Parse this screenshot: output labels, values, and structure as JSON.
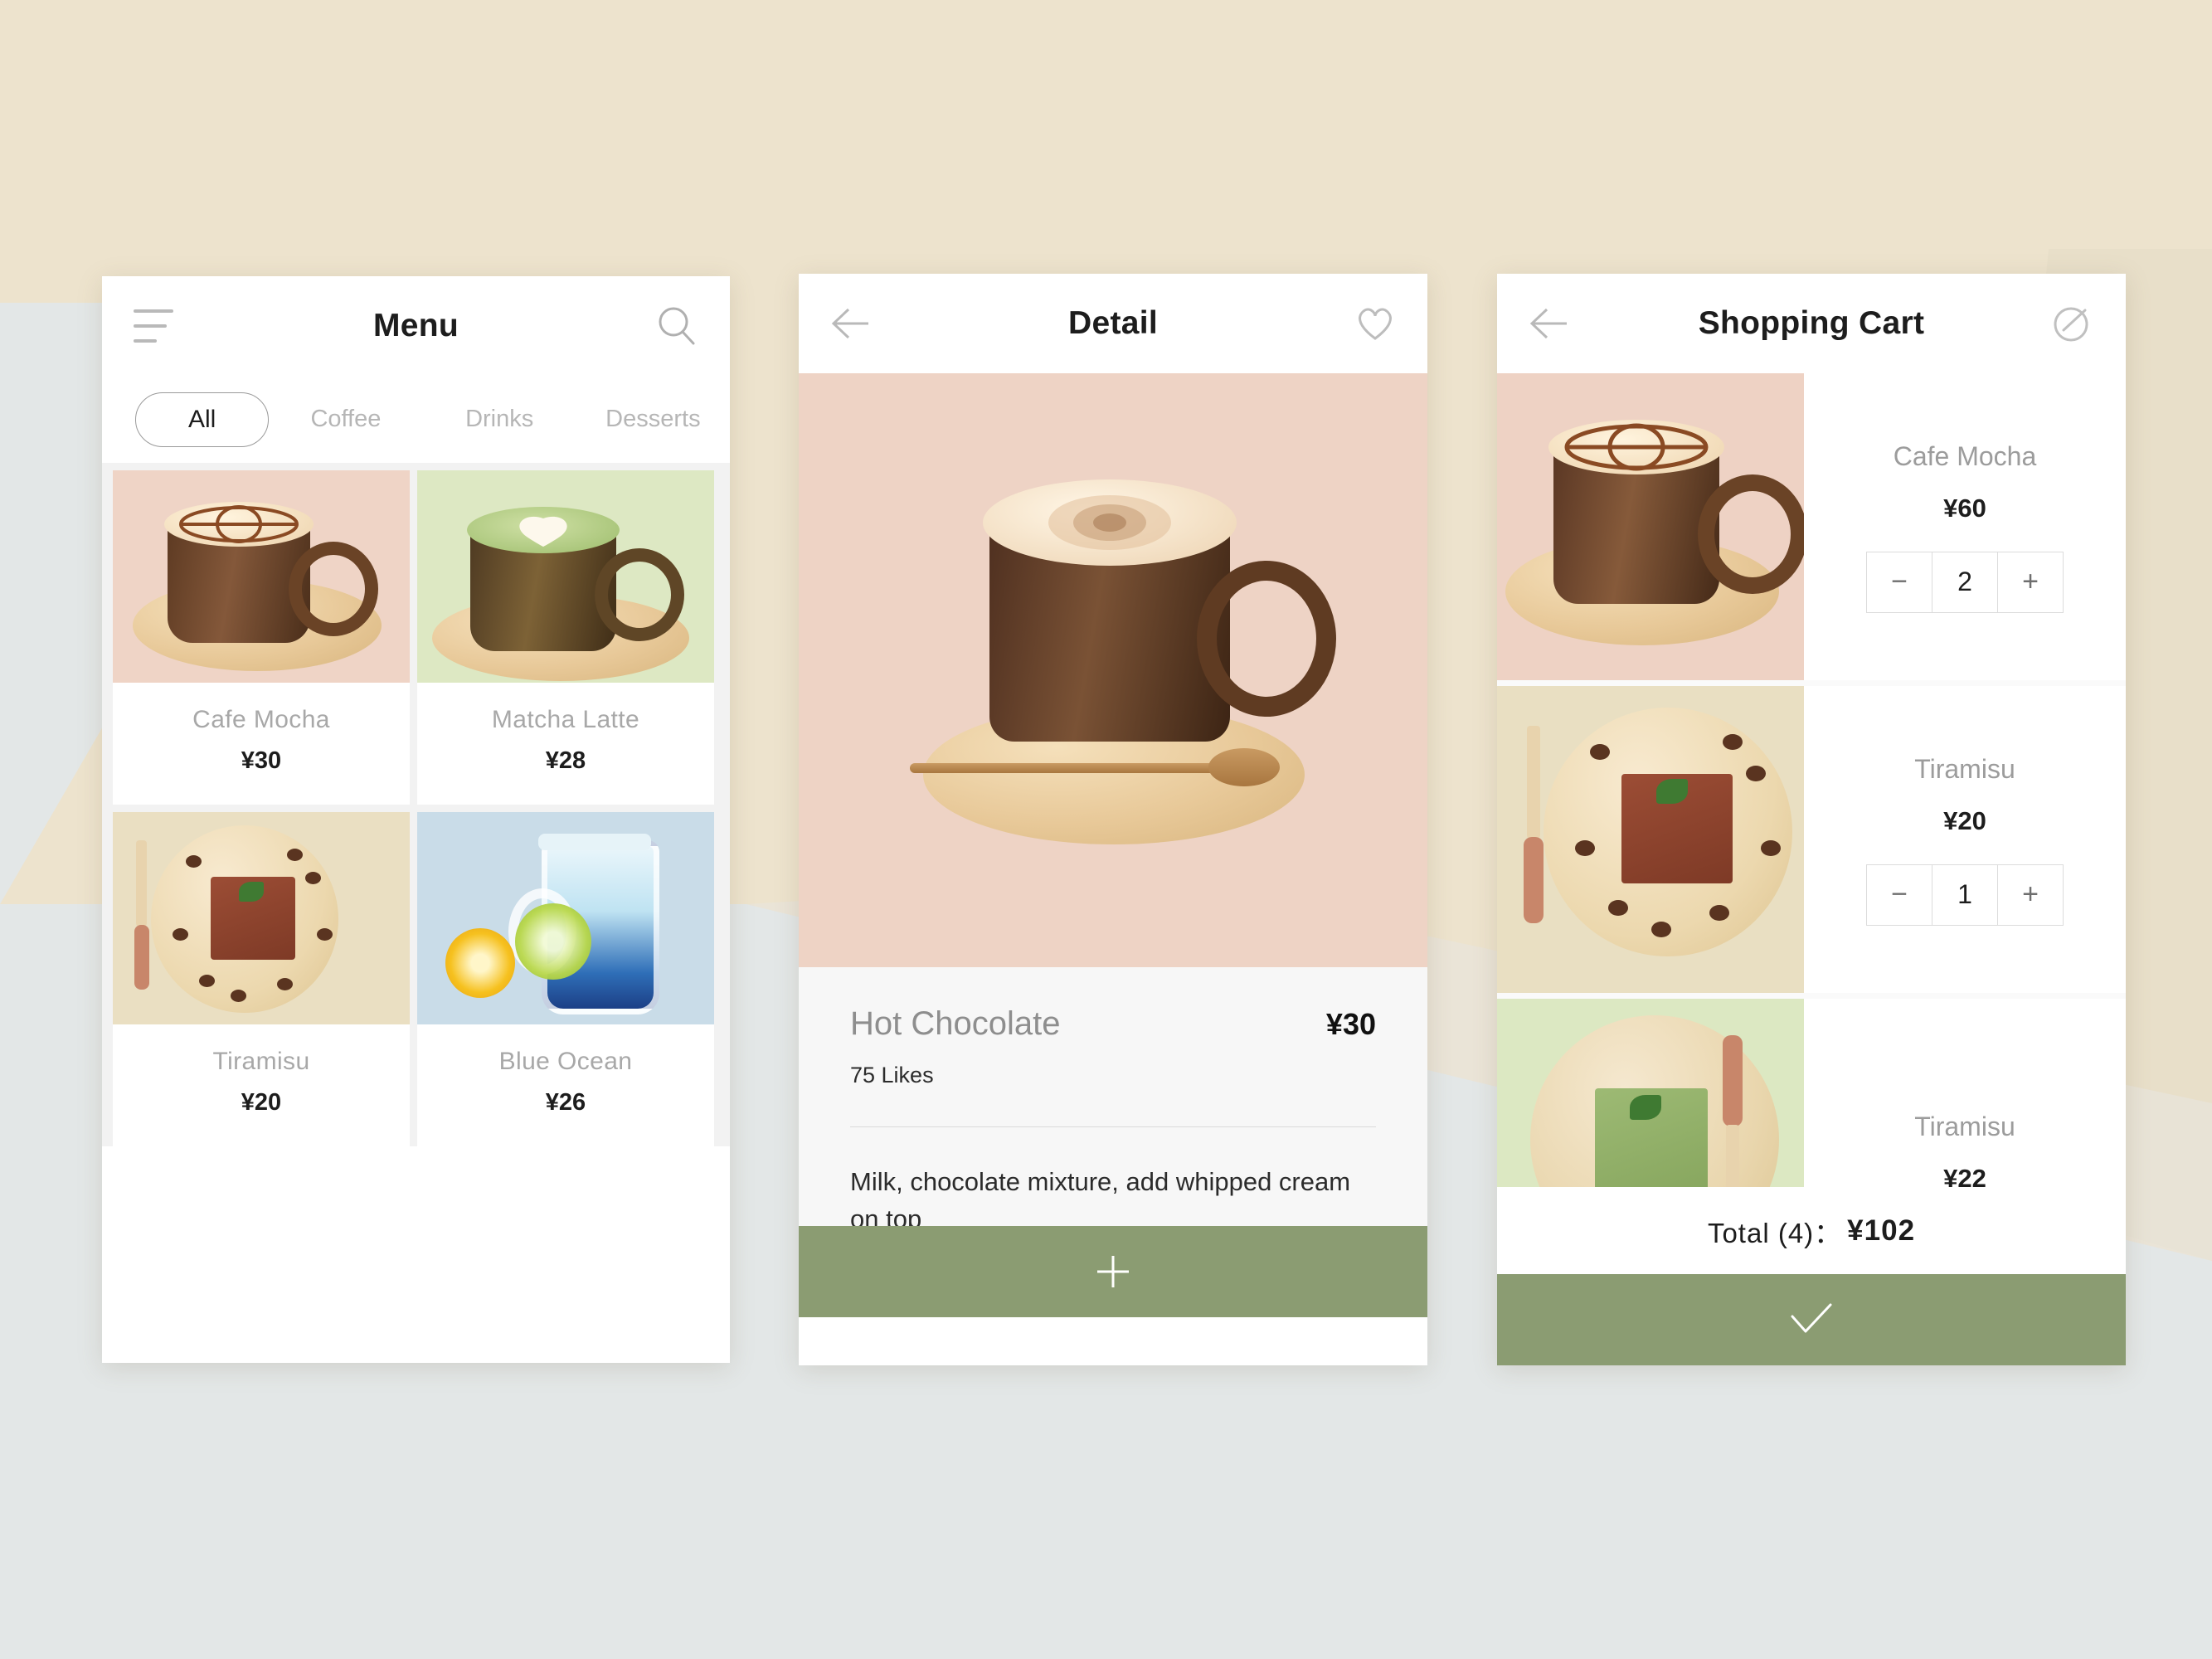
{
  "palette": {
    "bg_beige": "#EDE3CD",
    "bg_gray": "#E2E6E6",
    "green_accent": "#8B9C72",
    "tile_pink": "#EFD4C6",
    "tile_green": "#DDE8C3",
    "tile_cream": "#EADFC2",
    "tile_blue": "#C9DCE8",
    "muted_text": "#A8A8A8"
  },
  "screens": {
    "menu": {
      "title": "Menu",
      "menu_icon": "hamburger-icon",
      "search_icon": "search-icon",
      "tabs": [
        {
          "label": "All",
          "active": true
        },
        {
          "label": "Coffee",
          "active": false
        },
        {
          "label": "Drinks",
          "active": false
        },
        {
          "label": "Desserts",
          "active": false
        }
      ],
      "items": [
        {
          "name": "Cafe Mocha",
          "price": "¥30",
          "tile": "pink",
          "art": "mocha"
        },
        {
          "name": "Matcha Latte",
          "price": "¥28",
          "tile": "green",
          "art": "matcha"
        },
        {
          "name": "Tiramisu",
          "price": "¥20",
          "tile": "cream",
          "art": "tiramisu"
        },
        {
          "name": "Blue Ocean",
          "price": "¥26",
          "tile": "blue",
          "art": "blueocean"
        }
      ]
    },
    "detail": {
      "title": "Detail",
      "back_icon": "arrow-left-icon",
      "favorite_icon": "heart-icon",
      "hero_tile": "pink",
      "hero_art": "mocha-hero",
      "product_name": "Hot Chocolate",
      "product_price": "¥30",
      "likes": "75 Likes",
      "description": "Milk, chocolate mixture, add whipped cream on top",
      "add_button_icon": "plus-icon"
    },
    "cart": {
      "title": "Shopping Cart",
      "back_icon": "arrow-left-icon",
      "edit_icon": "edit-circle-icon",
      "items": [
        {
          "name": "Cafe Mocha",
          "price": "¥60",
          "qty": "2",
          "tile": "pink",
          "art": "mocha",
          "has_stepper": true,
          "minus": "−",
          "plus": "+"
        },
        {
          "name": "Tiramisu",
          "price": "¥20",
          "qty": "1",
          "tile": "cream",
          "art": "tiramisu",
          "has_stepper": true,
          "minus": "−",
          "plus": "+"
        },
        {
          "name": "Tiramisu",
          "price": "¥22",
          "qty": "",
          "tile": "green",
          "art": "matchacake",
          "has_stepper": false,
          "minus": "−",
          "plus": "+"
        }
      ],
      "total_label": "Total (4)：",
      "total_value": "¥102",
      "confirm_icon": "check-icon"
    }
  }
}
